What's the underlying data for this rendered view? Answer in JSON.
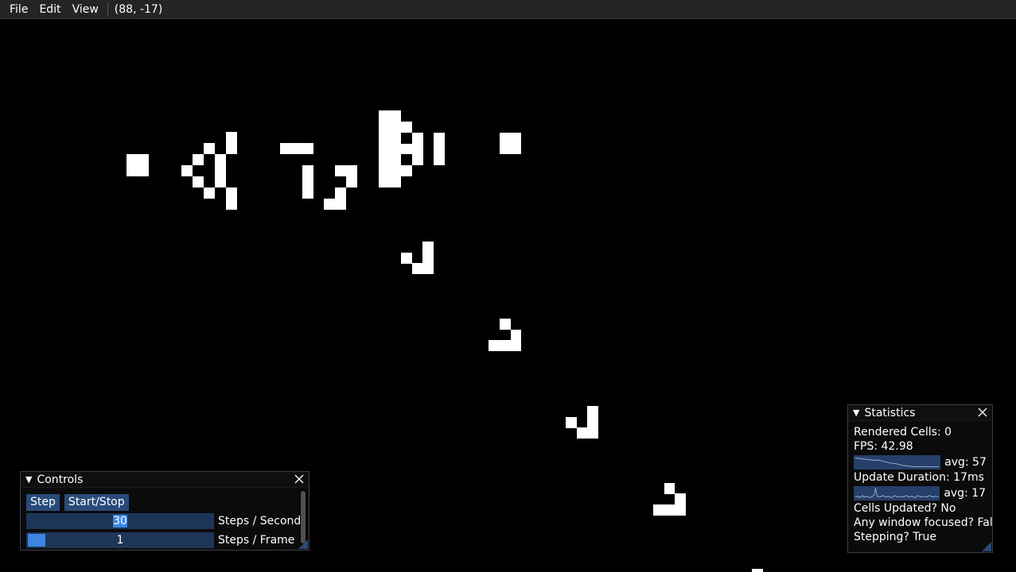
{
  "menu": {
    "file": "File",
    "edit": "Edit",
    "view": "View",
    "coords": "(88, -17)"
  },
  "controls": {
    "title": "Controls",
    "step_label": "Step",
    "start_stop_label": "Start/Stop",
    "steps_per_second_value": "30",
    "steps_per_second_label": "Steps / Second",
    "steps_per_frame_value": "1",
    "steps_per_frame_label": "Steps / Frame"
  },
  "statistics": {
    "title": "Statistics",
    "rendered_cells": "Rendered Cells: 0",
    "fps": "FPS: 42.98",
    "fps_avg": "avg: 57.",
    "update_duration": "Update Duration: 17ms",
    "update_avg": "avg: 17r",
    "cells_updated": "Cells Updated? No",
    "any_window_focused": "Any window focused? False",
    "stepping": "Stepping? True"
  },
  "colors": {
    "background": "#000000",
    "cell": "#ffffff",
    "accent": "#3d85e0",
    "frame": "#294a7a"
  },
  "icons": {
    "collapse": "collapse-triangle-icon",
    "close": "close-icon"
  }
}
